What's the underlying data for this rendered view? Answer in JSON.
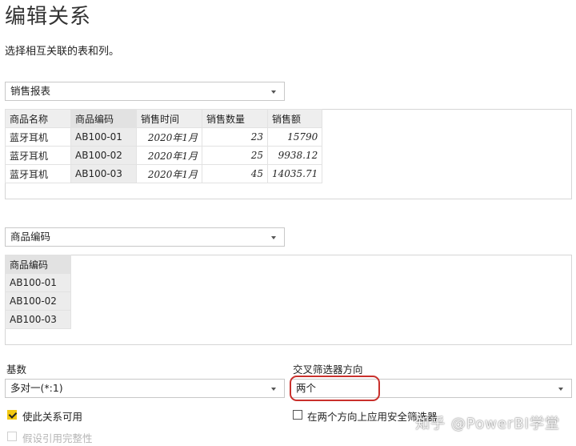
{
  "dialog": {
    "title": "编辑关系",
    "subtitle": "选择相互关联的表和列。"
  },
  "table1": {
    "selected": "销售报表",
    "headers": [
      "商品名称",
      "商品编码",
      "销售时间",
      "销售数量",
      "销售额"
    ],
    "rows": [
      [
        "蓝牙耳机",
        "AB100-01",
        "2020年1月",
        "23",
        "15790"
      ],
      [
        "蓝牙耳机",
        "AB100-02",
        "2020年1月",
        "25",
        "9938.12"
      ],
      [
        "蓝牙耳机",
        "AB100-03",
        "2020年1月",
        "45",
        "14035.71"
      ]
    ]
  },
  "table2": {
    "selected": "商品编码",
    "header": "商品编码",
    "rows": [
      "AB100-01",
      "AB100-02",
      "AB100-03"
    ]
  },
  "cardinality": {
    "label": "基数",
    "value": "多对一(*:1)"
  },
  "cross_filter": {
    "label": "交叉筛选器方向",
    "value": "两个"
  },
  "options": {
    "activate": "使此关系可用",
    "assume_integrity": "假设引用完整性",
    "security_filter": "在两个方向上应用安全筛选器"
  },
  "watermark": "知乎 @PowerBI学堂",
  "colors": {
    "accent_yellow": "#f2c811",
    "highlight_red": "#c9302c",
    "selected_column_bg": "#ececec"
  },
  "icons": [
    "chevron-down-icon",
    "checkmark-icon"
  ]
}
